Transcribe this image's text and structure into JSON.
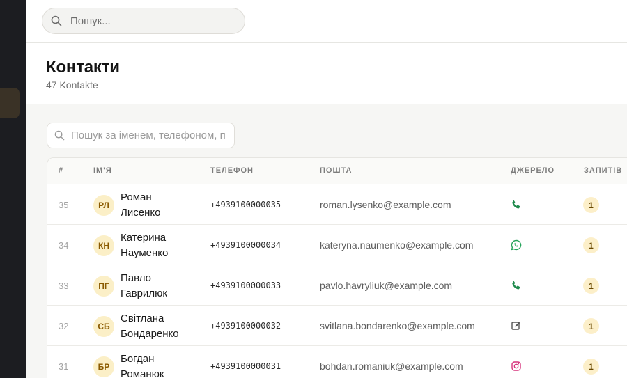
{
  "top_search": {
    "placeholder": "Пошук..."
  },
  "header": {
    "title": "Контакти",
    "subtitle": "47 Kontakte"
  },
  "filter": {
    "placeholder": "Пошук за іменем, телефоном, п"
  },
  "columns": {
    "num": "#",
    "name": "Ім'я",
    "phone": "Телефон",
    "email": "Пошта",
    "source": "Джерело",
    "requests": "Запитів"
  },
  "colors": {
    "accent": "#fbefc7",
    "phone_green": "#1f8a4c",
    "whatsapp_green": "#25a35a",
    "instagram_pink": "#d6337c",
    "form_gray": "#555555"
  },
  "rows": [
    {
      "num": "35",
      "initials": "РЛ",
      "name_first": "Роман",
      "name_last": "Лисенко",
      "phone": "+4939100000035",
      "email": "roman.lysenko@example.com",
      "source": "phone-icon",
      "requests": "1"
    },
    {
      "num": "34",
      "initials": "КН",
      "name_first": "Катерина",
      "name_last": "Науменко",
      "phone": "+4939100000034",
      "email": "kateryna.naumenko@example.com",
      "source": "whatsapp-icon",
      "requests": "1"
    },
    {
      "num": "33",
      "initials": "ПГ",
      "name_first": "Павло",
      "name_last": "Гаврилюк",
      "phone": "+4939100000033",
      "email": "pavlo.havryliuk@example.com",
      "source": "phone-icon",
      "requests": "1"
    },
    {
      "num": "32",
      "initials": "СБ",
      "name_first": "Світлана",
      "name_last": "Бондаренко",
      "phone": "+4939100000032",
      "email": "svitlana.bondarenko@example.com",
      "source": "form-edit-icon",
      "requests": "1"
    },
    {
      "num": "31",
      "initials": "БР",
      "name_first": "Богдан",
      "name_last": "Романюк",
      "phone": "+4939100000031",
      "email": "bohdan.romaniuk@example.com",
      "source": "instagram-icon",
      "requests": "1"
    }
  ]
}
